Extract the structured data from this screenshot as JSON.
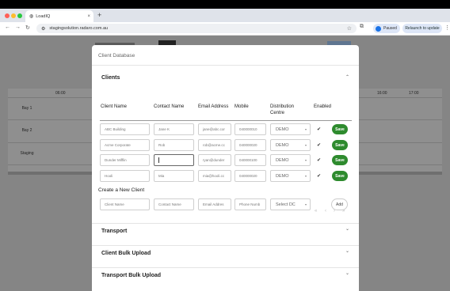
{
  "browser": {
    "tab_title": "LoadIQ",
    "tab_close": "×",
    "new_tab": "+",
    "url": "stagingsolution.radaro.com.au",
    "paused_label": "Paused",
    "relaunch_label": "Relaunch to update",
    "back": "←",
    "forward": "→",
    "reload": "↻",
    "star": "☆",
    "more": "⋮",
    "window_dot_colors": [
      "#ff5f57",
      "#febc2e",
      "#28c840"
    ]
  },
  "background": {
    "times": [
      "06:00",
      "16:00",
      "17:00"
    ],
    "rows": [
      "Bay 1",
      "Bay 2",
      "Staging"
    ]
  },
  "modal": {
    "title": "Client Database",
    "clients_section": {
      "heading": "Clients",
      "columns": [
        "Client Name",
        "Contact Name",
        "Email Address",
        "Mobile",
        "Distribution Centre",
        "Enabled"
      ],
      "rows": [
        {
          "client": "ABC Building",
          "contact": "Jane K",
          "email": "jane@abc.cor",
          "mobile": "040000010",
          "dc": "DEMO",
          "enabled": true,
          "save": "Save"
        },
        {
          "client": "Acme Corporate",
          "contact": "Rob",
          "email": "rob@acme.cc",
          "mobile": "040000020",
          "dc": "DEMO",
          "enabled": true,
          "save": "Save"
        },
        {
          "client": "Dunder Mifflin",
          "contact": "",
          "email": "ryan@dunder",
          "mobile": "040000100",
          "dc": "DEMO",
          "enabled": true,
          "save": "Save"
        },
        {
          "client": "Hooli",
          "contact": "Mia",
          "email": "mia@hooli.cc",
          "mobile": "040000020",
          "dc": "DEMO",
          "enabled": true,
          "save": "Save"
        }
      ]
    },
    "create_section": {
      "heading": "Create a New Client",
      "client_placeholder": "Client Name",
      "contact_placeholder": "Contact Name",
      "email_placeholder": "Email Addres",
      "phone_placeholder": "Phone Numb",
      "dc_placeholder": "Select DC",
      "add_label": "Add"
    },
    "pager": {
      "first": "«",
      "prev": "‹",
      "next": "›",
      "last": "»"
    },
    "sections": [
      {
        "heading": "Transport"
      },
      {
        "heading": "Client Bulk Upload"
      },
      {
        "heading": "Transport Bulk Upload"
      }
    ],
    "chevron_up": "⌃",
    "chevron_down": "⌄",
    "check_mark": "✔",
    "select_arrow": "▾"
  }
}
